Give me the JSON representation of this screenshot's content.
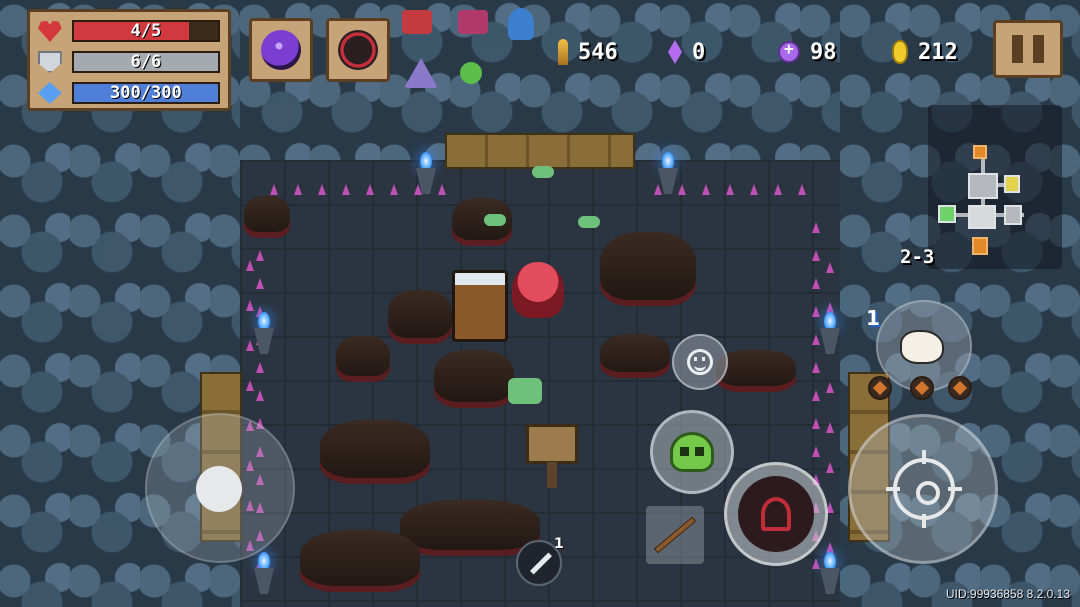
{
  "hud": {
    "stats": [
      {
        "name": "health",
        "text": "4/5",
        "value": 4,
        "max": 5
      },
      {
        "name": "armor",
        "text": "6/6",
        "value": 6,
        "max": 6
      },
      {
        "name": "energy",
        "text": "300/300",
        "value": 300,
        "max": 300
      }
    ],
    "skills": [
      {
        "icon": "dark-orb-skill-icon",
        "color": "#7a3fd0"
      },
      {
        "icon": "rune-skill-icon",
        "color": "#c72f3d"
      }
    ],
    "buffs": [
      {
        "icon": "hp-up-buff-icon",
        "color": "#c33a3f"
      },
      {
        "icon": "percent-buff-icon",
        "color": "#b23a6a"
      },
      {
        "icon": "spirit-buff-icon",
        "color": "#3d7fcf"
      },
      {
        "icon": "wizard-hat-buff-icon",
        "color": "#8a78c8"
      },
      {
        "icon": "clover-buff-icon",
        "color": "#5bbf4a"
      }
    ],
    "currencies": {
      "bullets": "546",
      "crystals": "0",
      "tokens": "98",
      "coins": "212"
    }
  },
  "minimap": {
    "level": "2-3"
  },
  "pet": {
    "count": "1"
  },
  "sword": {
    "count": "1"
  },
  "footer": {
    "uid": "UID:99936858 8.2.0.13"
  },
  "colors": {
    "hp": "#d0393d",
    "armor": "#a4aab0",
    "energy": "#4f7fd8",
    "panel": "#c7a478",
    "spike": "#c04fb3"
  }
}
